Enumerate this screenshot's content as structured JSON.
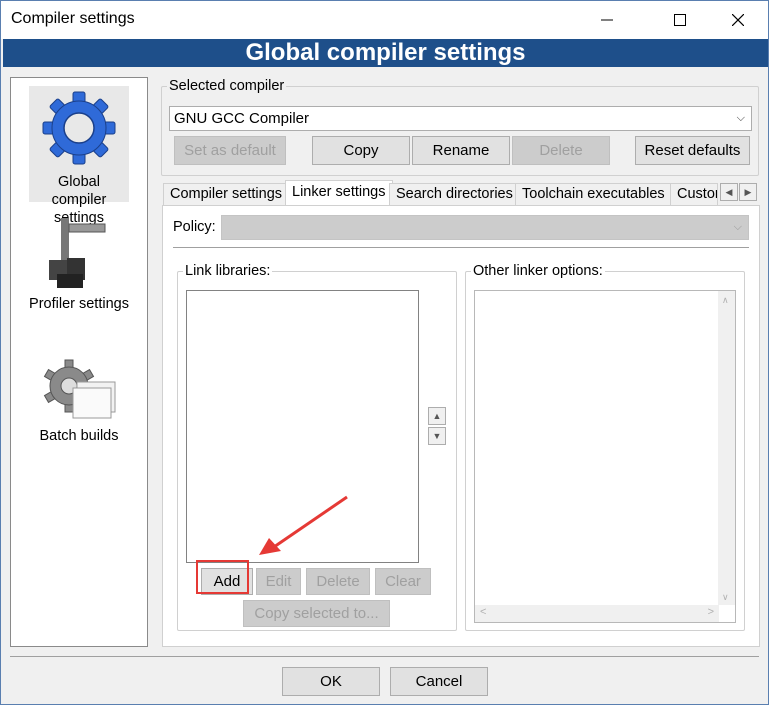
{
  "window": {
    "title": "Compiler settings"
  },
  "banner": {
    "title": "Global compiler settings"
  },
  "sidebar": {
    "items": [
      {
        "label": "Global compiler\nsettings",
        "icon": "gear-icon",
        "selected": true
      },
      {
        "label": "Profiler settings",
        "icon": "caliper-icon",
        "selected": false
      },
      {
        "label": "Batch builds",
        "icon": "gear-pages-icon",
        "selected": false
      }
    ]
  },
  "compiler": {
    "group_label": "Selected compiler",
    "selected": "GNU GCC Compiler",
    "buttons": {
      "set_default": "Set as default",
      "copy": "Copy",
      "rename": "Rename",
      "delete": "Delete",
      "reset": "Reset defaults"
    }
  },
  "tabs": [
    {
      "label": "Compiler settings"
    },
    {
      "label": "Linker settings",
      "active": true
    },
    {
      "label": "Search directories"
    },
    {
      "label": "Toolchain executables"
    },
    {
      "label": "Custor"
    }
  ],
  "linker": {
    "policy_label": "Policy:",
    "policy_value": "",
    "link_libraries_label": "Link libraries:",
    "other_options_label": "Other linker options:",
    "buttons": {
      "add": "Add",
      "edit": "Edit",
      "delete": "Delete",
      "clear": "Clear",
      "copy_selected": "Copy selected to..."
    }
  },
  "footer": {
    "ok": "OK",
    "cancel": "Cancel"
  },
  "annotation": {
    "color": "#e53935"
  }
}
